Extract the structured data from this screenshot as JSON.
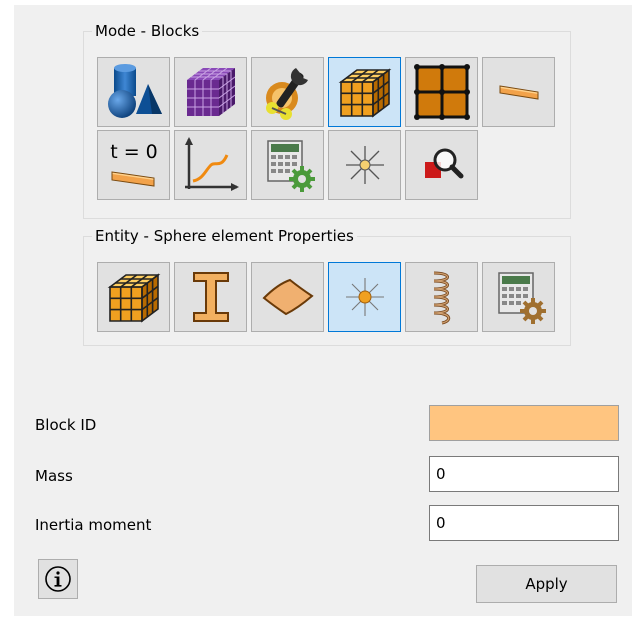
{
  "mode_group": {
    "title": "Mode - Blocks",
    "buttons": [
      {
        "icon": "geometry-icon",
        "active": false
      },
      {
        "icon": "mesh-cube-icon",
        "active": false
      },
      {
        "icon": "settings-tools-icon",
        "active": false
      },
      {
        "icon": "blocks-cube-icon",
        "active": true
      },
      {
        "icon": "grid-faces-icon",
        "active": false
      },
      {
        "icon": "beam-section-icon",
        "active": false
      },
      {
        "icon": "initial-condition-icon",
        "label": "t = 0",
        "active": false
      },
      {
        "icon": "curve-graph-icon",
        "active": false
      },
      {
        "icon": "calculator-settings-icon",
        "active": false
      },
      {
        "icon": "sphere-element-icon",
        "active": false
      },
      {
        "icon": "inspect-magnifier-icon",
        "active": false
      }
    ]
  },
  "entity_group": {
    "title": "Entity - Sphere element Properties",
    "buttons": [
      {
        "icon": "solid-block-icon",
        "active": false
      },
      {
        "icon": "beam-ibeam-icon",
        "active": false
      },
      {
        "icon": "shell-plate-icon",
        "active": false
      },
      {
        "icon": "sphere-element-icon",
        "active": true
      },
      {
        "icon": "spring-coil-icon",
        "active": false
      },
      {
        "icon": "calculator-settings-icon",
        "active": false
      }
    ]
  },
  "form": {
    "block_id_label": "Block ID",
    "block_id_value": "",
    "block_id_color": "#ffc580",
    "mass_label": "Mass",
    "mass_value": "0",
    "inertia_label": "Inertia moment",
    "inertia_value": "0",
    "apply_label": "Apply",
    "info_symbol": "ⓘ"
  },
  "colors": {
    "active_button_bg": "#cce4f7",
    "active_button_border": "#0078d7",
    "panel_bg": "#f0f0f0",
    "accent_orange": "#f0a030"
  }
}
